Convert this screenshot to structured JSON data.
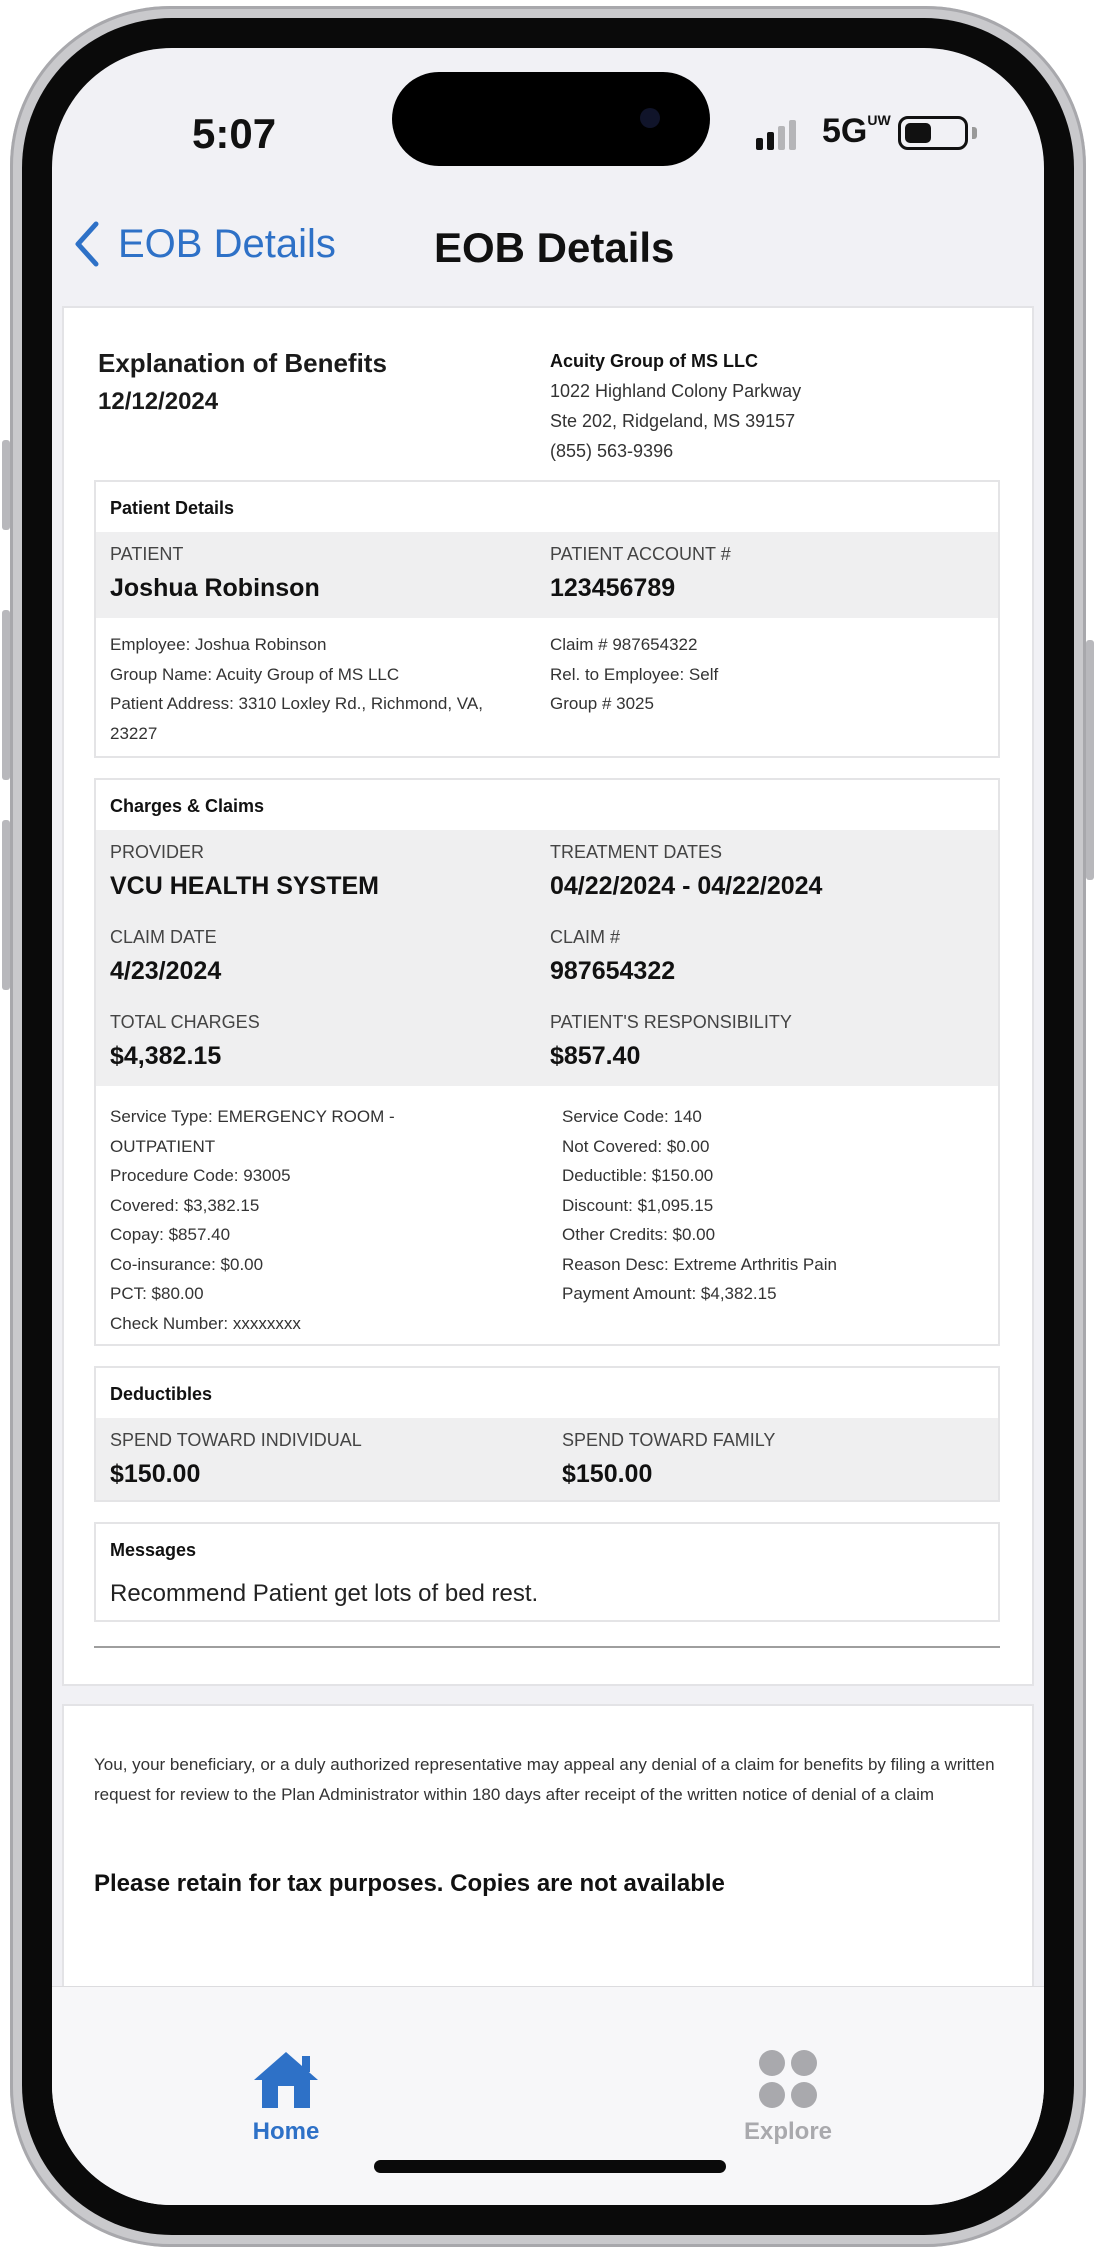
{
  "status_bar": {
    "time": "5:07",
    "network": "5G",
    "network_suffix": "UW"
  },
  "nav": {
    "back_label": "EOB Details",
    "title": "EOB Details"
  },
  "eob": {
    "title": "Explanation of Benefits",
    "date": "12/12/2024"
  },
  "company": {
    "name": "Acuity Group of MS LLC",
    "address1": "1022 Highland Colony Parkway",
    "address2": "Ste 202, Ridgeland, MS 39157",
    "phone": "(855) 563-9396"
  },
  "patient_details": {
    "heading": "Patient Details",
    "patient_label": "PATIENT",
    "patient_name": "Joshua Robinson",
    "account_label": "PATIENT ACCOUNT #",
    "account_number": "123456789",
    "left_lines": [
      "Employee: Joshua Robinson",
      "Group Name: Acuity Group of MS LLC",
      "Patient Address: 3310 Loxley Rd., Richmond, VA,",
      "23227"
    ],
    "right_lines": [
      "Claim # 987654322",
      "Rel. to Employee: Self",
      "Group # 3025"
    ]
  },
  "charges": {
    "heading": "Charges & Claims",
    "provider_label": "PROVIDER",
    "provider": "VCU HEALTH SYSTEM",
    "treatment_label": "TREATMENT DATES",
    "treatment_dates": "04/22/2024 - 04/22/2024",
    "claim_date_label": "CLAIM DATE",
    "claim_date": "4/23/2024",
    "claim_no_label": "CLAIM #",
    "claim_no": "987654322",
    "total_label": "TOTAL CHARGES",
    "total": "$4,382.15",
    "responsibility_label": "PATIENT'S RESPONSIBILITY",
    "responsibility": "$857.40",
    "left_lines": [
      "Service Type: EMERGENCY ROOM -",
      "OUTPATIENT",
      "Procedure Code: 93005",
      "Covered: $3,382.15",
      "Copay: $857.40",
      "Co-insurance: $0.00",
      "PCT: $80.00",
      "Check Number: xxxxxxxx"
    ],
    "right_lines": [
      "Service Code: 140",
      "Not Covered: $0.00",
      "Deductible: $150.00",
      "Discount: $1,095.15",
      "Other Credits: $0.00",
      "Reason Desc: Extreme Arthritis Pain",
      "Payment Amount: $4,382.15"
    ]
  },
  "deductibles": {
    "heading": "Deductibles",
    "individual_label": "SPEND TOWARD INDIVIDUAL",
    "individual": "$150.00",
    "family_label": "SPEND TOWARD FAMILY",
    "family": "$150.00"
  },
  "messages": {
    "heading": "Messages",
    "text": "Recommend Patient get lots of bed rest."
  },
  "disclaimer": "You, your beneficiary, or a duly authorized representative may appeal any denial of a claim for benefits by filing a written request for review to the Plan Administrator within 180 days after receipt of the written notice of denial of a claim",
  "retain_notice": "Please retain for tax purposes. Copies are not available",
  "tabs": [
    {
      "label": "Home",
      "icon": "home-icon",
      "active": true
    },
    {
      "label": "Explore",
      "icon": "grid-icon",
      "active": false
    }
  ],
  "colors": {
    "accent": "#2e71c7",
    "inactive": "#a9a9ad",
    "band": "#efeff0"
  }
}
